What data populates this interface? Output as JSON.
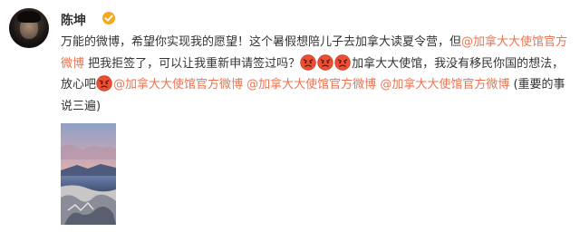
{
  "user": {
    "name": "陈坤",
    "verified_color": "#f5a623"
  },
  "post": {
    "line1": {
      "text": "万能的微博，希望你实现我的愿望！这个暑假想陪儿子去加拿大读夏令营，但",
      "mention": "@加拿大大使馆官方"
    },
    "line2": {
      "mention_tail": "微博",
      "text": " 把我拒签了，可以让我重新申请签过吗？",
      "emoji": "angry-face-emoji",
      "text_after_emojis": "加拿大大使馆，我没有移民你国的想法，"
    },
    "line3": {
      "text": "放心吧",
      "mention": "@加拿大大使馆官方微博",
      "mention_2": "@加拿大大使馆官方微博",
      "mention_3": "@加拿大大使馆官方微博",
      "tail": " (重要的事"
    },
    "line4": {
      "text": "说三遍)"
    },
    "image": {
      "description_icon": "landscape-photo"
    }
  },
  "colors": {
    "text": "#333333",
    "mention": "#eb7350",
    "background": "#ffffff"
  }
}
